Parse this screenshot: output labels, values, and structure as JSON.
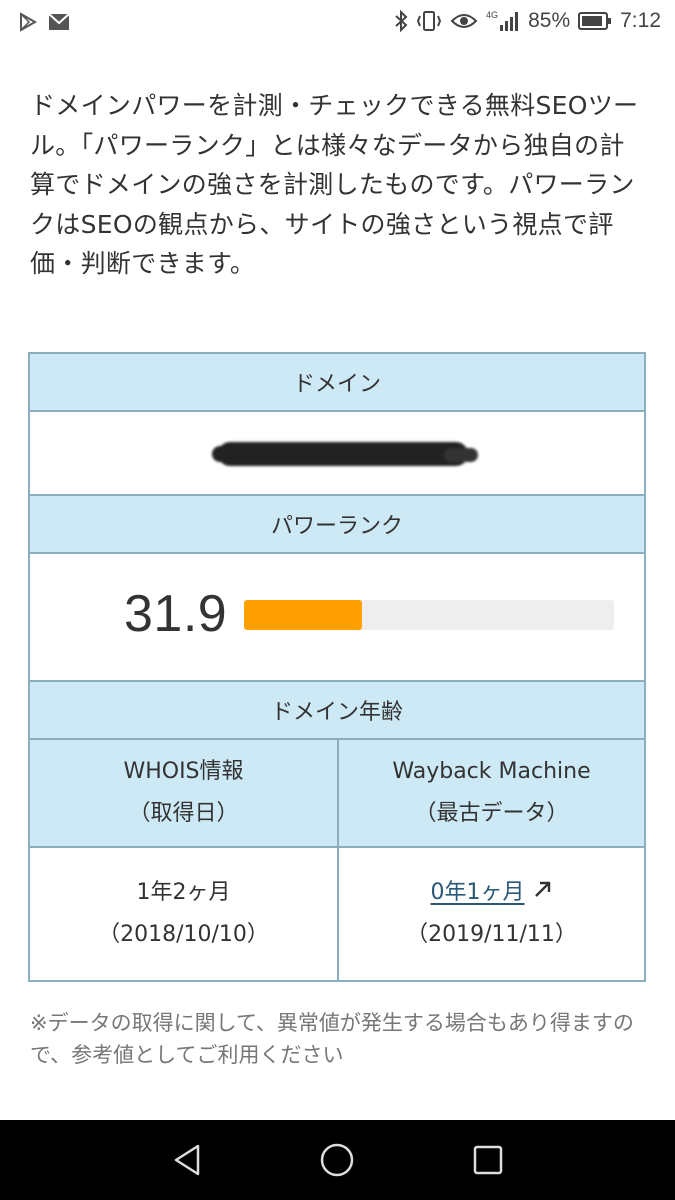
{
  "status_bar": {
    "battery": "85%",
    "time": "7:12",
    "network": "4G",
    "icons": [
      "play-store-icon",
      "gmail-icon",
      "bluetooth-icon",
      "vibrate-icon",
      "eye-icon",
      "signal-icon",
      "battery-icon"
    ]
  },
  "description": "ドメインパワーを計測・チェックできる無料SEOツール。「パワーランク」とは様々なデータから独自の計算でドメインの強さを計測したものです。パワーランクはSEOの観点から、サイトの強さという視点で評価・判断できます。",
  "table": {
    "domain_header": "ドメイン",
    "power_rank_header": "パワーランク",
    "power_rank_value": "31.9",
    "power_rank_fraction": 0.319,
    "domain_age_header": "ドメイン年齢",
    "whois": {
      "title": "WHOIS情報",
      "subtitle": "（取得日）",
      "age": "1年2ヶ月",
      "date": "（2018/10/10）"
    },
    "wayback": {
      "title": "Wayback Machine",
      "subtitle": "（最古データ）",
      "age": "0年1ヶ月",
      "date": "（2019/11/11）"
    }
  },
  "note": "※データの取得に関して、異常値が発生する場合もあり得ますので、参考値としてご利用ください",
  "colors": {
    "header_bg": "#cde9f5",
    "border": "#8aaebd",
    "bar_fill": "#ff9f00",
    "bar_track": "#eeeeee",
    "link": "#2a5877"
  }
}
